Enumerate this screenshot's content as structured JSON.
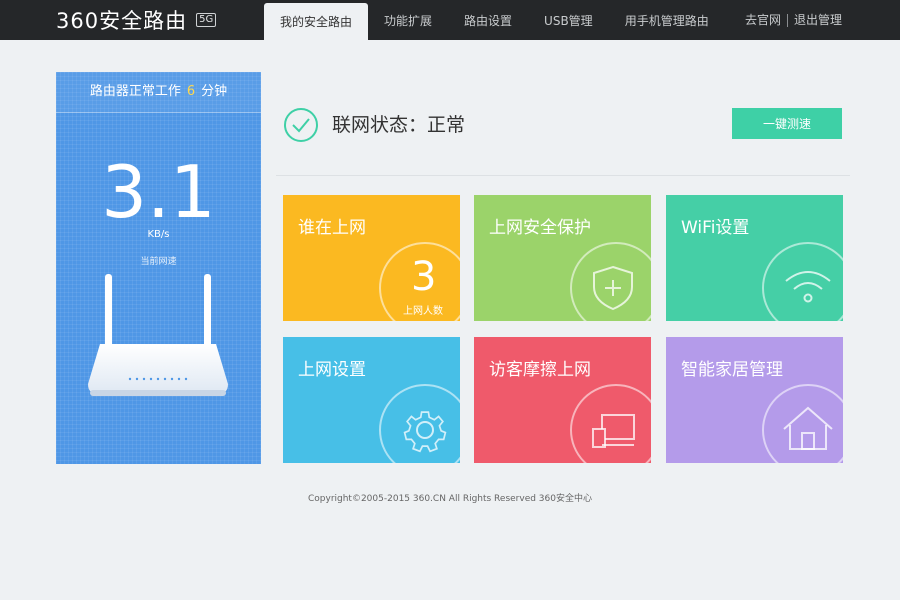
{
  "brand": {
    "name": "360安全路由",
    "badge": "5G"
  },
  "nav": {
    "tabs": [
      {
        "label": "我的安全路由",
        "active": true
      },
      {
        "label": "功能扩展",
        "active": false
      },
      {
        "label": "路由设置",
        "active": false
      },
      {
        "label": "USB管理",
        "active": false
      },
      {
        "label": "用手机管理路由",
        "active": false
      }
    ],
    "links": {
      "official_site": "去官网",
      "logout": "退出管理"
    }
  },
  "router_panel": {
    "uptime_prefix": "路由器正常工作",
    "uptime_value": "6",
    "uptime_unit": "分钟",
    "speed_value": "3.1",
    "speed_unit": "KB/s",
    "speed_caption": "当前网速"
  },
  "status": {
    "label": "联网状态：正常",
    "speedtest_button": "一键测速"
  },
  "tiles": [
    {
      "title": "谁在上网",
      "count": "3",
      "count_label": "上网人数",
      "color": "#fbb921",
      "icon": "online-count"
    },
    {
      "title": "上网安全保护",
      "color": "#9bd36a",
      "icon": "shield-plus-icon"
    },
    {
      "title": "WiFi设置",
      "color": "#45cfa6",
      "icon": "wifi-icon"
    },
    {
      "title": "上网设置",
      "color": "#47bfe7",
      "icon": "gear-icon"
    },
    {
      "title": "访客摩擦上网",
      "color": "#ef5a6b",
      "icon": "devices-icon"
    },
    {
      "title": "智能家居管理",
      "color": "#b49bea",
      "icon": "house-icon"
    }
  ],
  "footer": {
    "text": "Copyright©2005-2015 360.CN All Rights Reserved 360安全中心"
  },
  "colors": {
    "topbar": "#252729",
    "panel_blue": "#4f97e6",
    "accent_green": "#3ed0a6",
    "status_green": "#3ed0a6"
  }
}
